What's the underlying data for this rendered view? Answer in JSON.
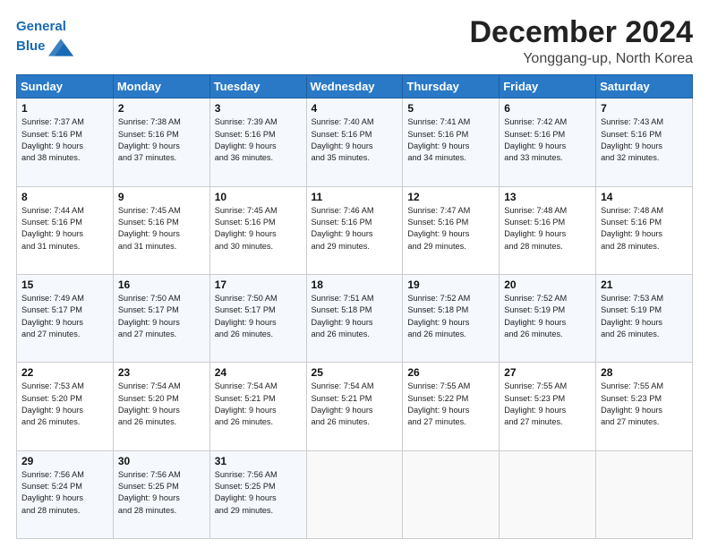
{
  "header": {
    "logo_line1": "General",
    "logo_line2": "Blue",
    "month": "December 2024",
    "location": "Yonggang-up, North Korea"
  },
  "weekdays": [
    "Sunday",
    "Monday",
    "Tuesday",
    "Wednesday",
    "Thursday",
    "Friday",
    "Saturday"
  ],
  "weeks": [
    [
      {
        "day": "1",
        "lines": [
          "Sunrise: 7:37 AM",
          "Sunset: 5:16 PM",
          "Daylight: 9 hours",
          "and 38 minutes."
        ]
      },
      {
        "day": "2",
        "lines": [
          "Sunrise: 7:38 AM",
          "Sunset: 5:16 PM",
          "Daylight: 9 hours",
          "and 37 minutes."
        ]
      },
      {
        "day": "3",
        "lines": [
          "Sunrise: 7:39 AM",
          "Sunset: 5:16 PM",
          "Daylight: 9 hours",
          "and 36 minutes."
        ]
      },
      {
        "day": "4",
        "lines": [
          "Sunrise: 7:40 AM",
          "Sunset: 5:16 PM",
          "Daylight: 9 hours",
          "and 35 minutes."
        ]
      },
      {
        "day": "5",
        "lines": [
          "Sunrise: 7:41 AM",
          "Sunset: 5:16 PM",
          "Daylight: 9 hours",
          "and 34 minutes."
        ]
      },
      {
        "day": "6",
        "lines": [
          "Sunrise: 7:42 AM",
          "Sunset: 5:16 PM",
          "Daylight: 9 hours",
          "and 33 minutes."
        ]
      },
      {
        "day": "7",
        "lines": [
          "Sunrise: 7:43 AM",
          "Sunset: 5:16 PM",
          "Daylight: 9 hours",
          "and 32 minutes."
        ]
      }
    ],
    [
      {
        "day": "8",
        "lines": [
          "Sunrise: 7:44 AM",
          "Sunset: 5:16 PM",
          "Daylight: 9 hours",
          "and 31 minutes."
        ]
      },
      {
        "day": "9",
        "lines": [
          "Sunrise: 7:45 AM",
          "Sunset: 5:16 PM",
          "Daylight: 9 hours",
          "and 31 minutes."
        ]
      },
      {
        "day": "10",
        "lines": [
          "Sunrise: 7:45 AM",
          "Sunset: 5:16 PM",
          "Daylight: 9 hours",
          "and 30 minutes."
        ]
      },
      {
        "day": "11",
        "lines": [
          "Sunrise: 7:46 AM",
          "Sunset: 5:16 PM",
          "Daylight: 9 hours",
          "and 29 minutes."
        ]
      },
      {
        "day": "12",
        "lines": [
          "Sunrise: 7:47 AM",
          "Sunset: 5:16 PM",
          "Daylight: 9 hours",
          "and 29 minutes."
        ]
      },
      {
        "day": "13",
        "lines": [
          "Sunrise: 7:48 AM",
          "Sunset: 5:16 PM",
          "Daylight: 9 hours",
          "and 28 minutes."
        ]
      },
      {
        "day": "14",
        "lines": [
          "Sunrise: 7:48 AM",
          "Sunset: 5:16 PM",
          "Daylight: 9 hours",
          "and 28 minutes."
        ]
      }
    ],
    [
      {
        "day": "15",
        "lines": [
          "Sunrise: 7:49 AM",
          "Sunset: 5:17 PM",
          "Daylight: 9 hours",
          "and 27 minutes."
        ]
      },
      {
        "day": "16",
        "lines": [
          "Sunrise: 7:50 AM",
          "Sunset: 5:17 PM",
          "Daylight: 9 hours",
          "and 27 minutes."
        ]
      },
      {
        "day": "17",
        "lines": [
          "Sunrise: 7:50 AM",
          "Sunset: 5:17 PM",
          "Daylight: 9 hours",
          "and 26 minutes."
        ]
      },
      {
        "day": "18",
        "lines": [
          "Sunrise: 7:51 AM",
          "Sunset: 5:18 PM",
          "Daylight: 9 hours",
          "and 26 minutes."
        ]
      },
      {
        "day": "19",
        "lines": [
          "Sunrise: 7:52 AM",
          "Sunset: 5:18 PM",
          "Daylight: 9 hours",
          "and 26 minutes."
        ]
      },
      {
        "day": "20",
        "lines": [
          "Sunrise: 7:52 AM",
          "Sunset: 5:19 PM",
          "Daylight: 9 hours",
          "and 26 minutes."
        ]
      },
      {
        "day": "21",
        "lines": [
          "Sunrise: 7:53 AM",
          "Sunset: 5:19 PM",
          "Daylight: 9 hours",
          "and 26 minutes."
        ]
      }
    ],
    [
      {
        "day": "22",
        "lines": [
          "Sunrise: 7:53 AM",
          "Sunset: 5:20 PM",
          "Daylight: 9 hours",
          "and 26 minutes."
        ]
      },
      {
        "day": "23",
        "lines": [
          "Sunrise: 7:54 AM",
          "Sunset: 5:20 PM",
          "Daylight: 9 hours",
          "and 26 minutes."
        ]
      },
      {
        "day": "24",
        "lines": [
          "Sunrise: 7:54 AM",
          "Sunset: 5:21 PM",
          "Daylight: 9 hours",
          "and 26 minutes."
        ]
      },
      {
        "day": "25",
        "lines": [
          "Sunrise: 7:54 AM",
          "Sunset: 5:21 PM",
          "Daylight: 9 hours",
          "and 26 minutes."
        ]
      },
      {
        "day": "26",
        "lines": [
          "Sunrise: 7:55 AM",
          "Sunset: 5:22 PM",
          "Daylight: 9 hours",
          "and 27 minutes."
        ]
      },
      {
        "day": "27",
        "lines": [
          "Sunrise: 7:55 AM",
          "Sunset: 5:23 PM",
          "Daylight: 9 hours",
          "and 27 minutes."
        ]
      },
      {
        "day": "28",
        "lines": [
          "Sunrise: 7:55 AM",
          "Sunset: 5:23 PM",
          "Daylight: 9 hours",
          "and 27 minutes."
        ]
      }
    ],
    [
      {
        "day": "29",
        "lines": [
          "Sunrise: 7:56 AM",
          "Sunset: 5:24 PM",
          "Daylight: 9 hours",
          "and 28 minutes."
        ]
      },
      {
        "day": "30",
        "lines": [
          "Sunrise: 7:56 AM",
          "Sunset: 5:25 PM",
          "Daylight: 9 hours",
          "and 28 minutes."
        ]
      },
      {
        "day": "31",
        "lines": [
          "Sunrise: 7:56 AM",
          "Sunset: 5:25 PM",
          "Daylight: 9 hours",
          "and 29 minutes."
        ]
      },
      {
        "day": "",
        "lines": []
      },
      {
        "day": "",
        "lines": []
      },
      {
        "day": "",
        "lines": []
      },
      {
        "day": "",
        "lines": []
      }
    ]
  ]
}
